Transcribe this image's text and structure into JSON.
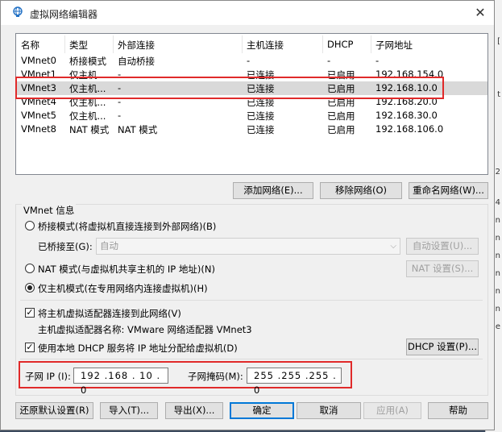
{
  "window": {
    "title": "虚拟网络编辑器",
    "close": "✕"
  },
  "table": {
    "headers": [
      "名称",
      "类型",
      "外部连接",
      "主机连接",
      "DHCP",
      "子网地址"
    ],
    "rows": [
      [
        "VMnet0",
        "桥接模式",
        "自动桥接",
        "-",
        "-",
        "-"
      ],
      [
        "VMnet1",
        "仅主机...",
        "-",
        "已连接",
        "已启用",
        "192.168.154.0"
      ],
      [
        "VMnet3",
        "仅主机...",
        "-",
        "已连接",
        "已启用",
        "192.168.10.0"
      ],
      [
        "VMnet4",
        "仅主机...",
        "-",
        "已连接",
        "已启用",
        "192.168.20.0"
      ],
      [
        "VMnet5",
        "仅主机...",
        "-",
        "已连接",
        "已启用",
        "192.168.30.0"
      ],
      [
        "VMnet8",
        "NAT 模式",
        "NAT 模式",
        "已连接",
        "已启用",
        "192.168.106.0"
      ]
    ]
  },
  "buttons": {
    "add": "添加网络(E)...",
    "remove": "移除网络(O)",
    "rename": "重命名网络(W)...",
    "auto_settings": "自动设置(U)...",
    "nat_settings": "NAT 设置(S)...",
    "dhcp_settings": "DHCP 设置(P)...",
    "restore": "还原默认设置(R)",
    "import": "导入(T)...",
    "export": "导出(X)...",
    "ok": "确定",
    "cancel": "取消",
    "apply": "应用(A)",
    "help": "帮助"
  },
  "info": {
    "group_label": "VMnet 信息",
    "bridge_label": "桥接模式(将虚拟机直接连接到外部网络)(B)",
    "bridged_to_label": "已桥接至(G):",
    "bridged_to_value": "自动",
    "nat_label": "NAT 模式(与虚拟机共享主机的 IP 地址)(N)",
    "hostonly_label": "仅主机模式(在专用网络内连接虚拟机)(H)",
    "connect_adapter_label": "将主机虚拟适配器连接到此网络(V)",
    "adapter_name_label": "主机虚拟适配器名称: VMware 网络适配器 VMnet3",
    "dhcp_label": "使用本地 DHCP 服务将 IP 地址分配给虚拟机(D)",
    "subnet_ip_label": "子网 IP (I):",
    "subnet_ip_value": "192 .168 . 10  . 0",
    "subnet_mask_label": "子网掩码(M):",
    "subnet_mask_value": "255 .255 .255 . 0"
  },
  "state": {
    "mode": "host-only",
    "connect_adapter": true,
    "use_dhcp": true,
    "selected_row": "VMnet3"
  },
  "colors": {
    "highlight_border": "#e02a2a",
    "selected_row": "#d9d9d9",
    "focus": "#0078d7"
  }
}
